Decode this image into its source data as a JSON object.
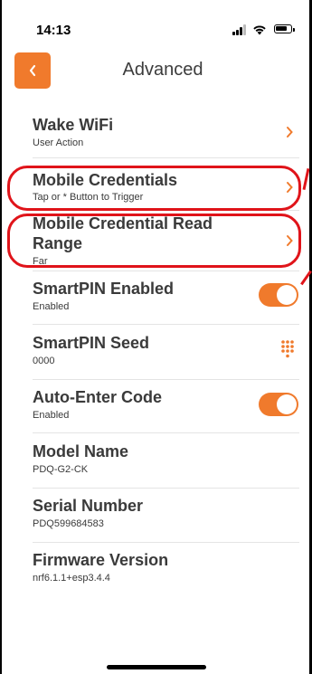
{
  "status_bar": {
    "time": "14:13",
    "icons": [
      "signal-icon",
      "wifi-icon",
      "battery-icon"
    ]
  },
  "nav": {
    "back_icon": "chevron-left-icon",
    "title": "Advanced"
  },
  "colors": {
    "accent": "#f07a2c",
    "annotation": "#e0141a",
    "text": "#3a3a3a"
  },
  "settings": {
    "items": [
      {
        "title": "Wake WiFi",
        "subtitle": "User Action",
        "control": "chevron"
      },
      {
        "title": "Mobile Credentials",
        "subtitle": "Tap or * Button to Trigger",
        "control": "chevron"
      },
      {
        "title": "Mobile Credential Read Range",
        "title_line1": "Mobile Credential Read",
        "title_line2": "Range",
        "subtitle": "Far",
        "control": "chevron"
      },
      {
        "title": "SmartPIN Enabled",
        "subtitle": "Enabled",
        "control": "toggle",
        "on": true
      },
      {
        "title": "SmartPIN Seed",
        "subtitle": "0000",
        "control": "keypad"
      },
      {
        "title": "Auto-Enter Code",
        "subtitle": "Enabled",
        "control": "toggle",
        "on": true
      },
      {
        "title": "Model Name",
        "subtitle": "PDQ-G2-CK",
        "control": "none"
      },
      {
        "title": "Serial Number",
        "subtitle": "PDQ599684583",
        "control": "none"
      },
      {
        "title": "Firmware Version",
        "subtitle": "nrf6.1.1+esp3.4.4",
        "control": "none"
      }
    ]
  }
}
